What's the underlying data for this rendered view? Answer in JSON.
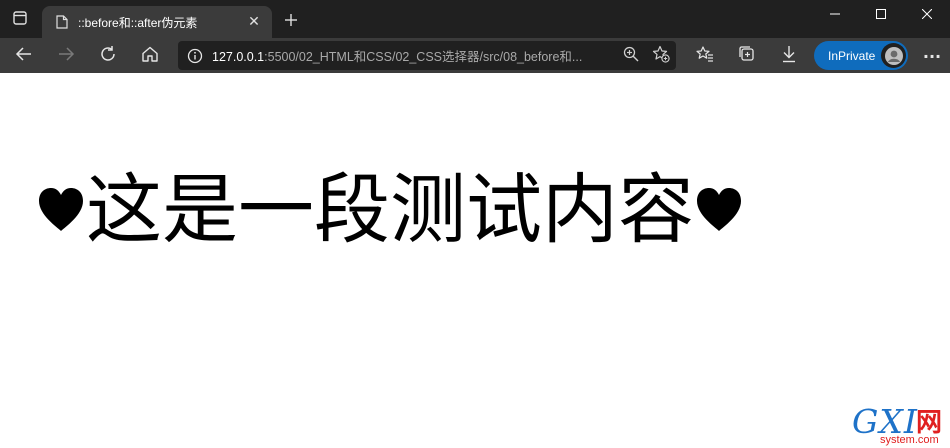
{
  "window": {
    "tab": {
      "title": "::before和::after伪元素",
      "close_glyph": "✕"
    },
    "new_tab_glyph": "+",
    "controls": [
      "minimize-icon",
      "maximize-icon",
      "close-icon"
    ]
  },
  "toolbar": {
    "back_icon": "arrow-left-icon",
    "forward_icon": "arrow-right-icon",
    "refresh_icon": "refresh-icon",
    "home_icon": "home-icon",
    "address": {
      "host": "127.0.0.1",
      "path": ":5500/02_HTML和CSS/02_CSS选择器/src/08_before和..."
    },
    "inprivate_label": "InPrivate",
    "more_glyph": "···"
  },
  "page": {
    "before_content": "♥",
    "text": "这是一段测试内容",
    "after_content": "♥"
  },
  "watermark": {
    "main": "GXI",
    "cn": "网",
    "sub": "system.com"
  },
  "colors": {
    "tabstrip": "#202020",
    "toolbar": "#3b3b3b",
    "address_bg": "#202020",
    "inprivate": "#0f6cbd",
    "watermark_blue": "#1e72c8",
    "watermark_red": "#e02020"
  }
}
